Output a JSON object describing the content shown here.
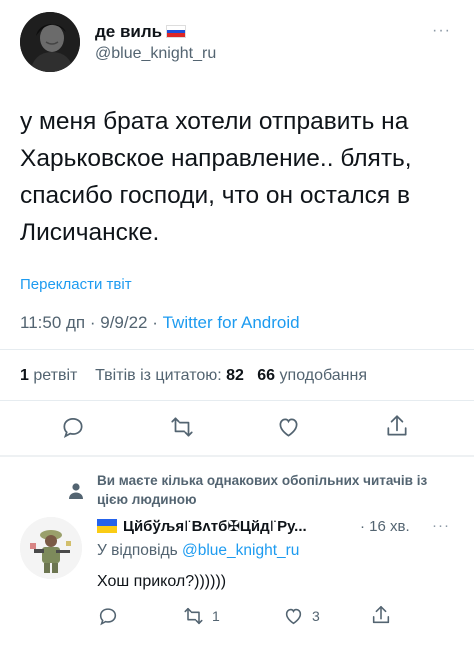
{
  "tweet": {
    "display_name": "де виль",
    "handle": "@blue_knight_ru",
    "more_label": "···",
    "text": "у меня брата хотели отправить на Харьковское направление.. блять, спасибо господи, что он остался в Лисичанске.",
    "translate_label": "Перекласти твіт",
    "timestamp": "11:50 дп · 9/9/22 · ",
    "source": "Twitter for Android",
    "stats": {
      "retweets_count": "1",
      "retweets_label": " ретвіт",
      "quotes_label": "Твітів із цитатою:",
      "quotes_count": "82",
      "likes_count": "66",
      "likes_label": " уподобання"
    },
    "actions": [
      "reply-icon",
      "retweet-icon",
      "like-icon",
      "share-icon"
    ]
  },
  "mutual_notice": {
    "text": "Ви маєте кілька однакових обопільних читачів із цією людиною",
    "icon": "person-icon"
  },
  "reply": {
    "display_name": "Цйбўљя꜍Вʌтб✠Цйд꜍Ру...",
    "time": "· 16 хв.",
    "more_label": "···",
    "reply_to_prefix": "У відповідь ",
    "reply_to_handle": "@blue_knight_ru",
    "text": "Хош прикол?))))))",
    "retweet_count": "1",
    "like_count": "3"
  },
  "colors": {
    "link": "#1d9bf0",
    "secondary_text": "#536471",
    "primary_text": "#0f1419"
  }
}
